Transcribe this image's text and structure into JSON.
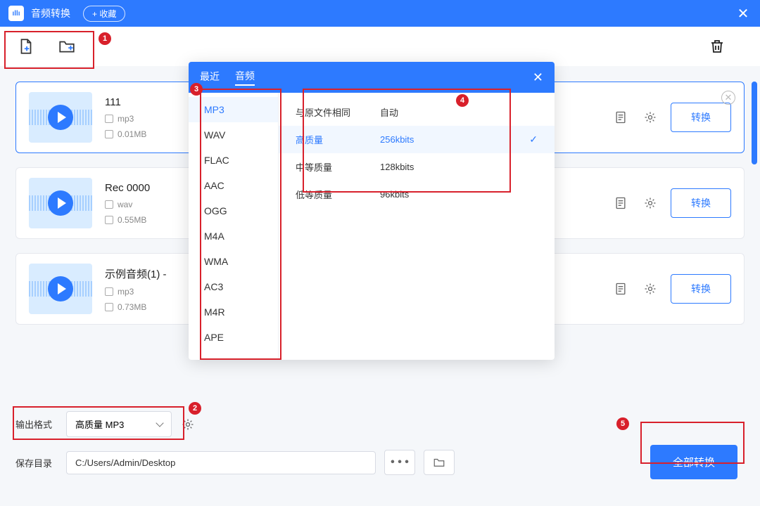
{
  "app": {
    "title": "音频转换",
    "favorite": "+ 收藏"
  },
  "popup": {
    "tabs": {
      "recent": "最近",
      "audio": "音频"
    },
    "formats": [
      "MP3",
      "WAV",
      "FLAC",
      "AAC",
      "OGG",
      "M4A",
      "WMA",
      "AC3",
      "M4R",
      "APE"
    ],
    "quality_rows": [
      {
        "label": "与原文件相同",
        "rate": "自动",
        "active": false
      },
      {
        "label": "高质量",
        "rate": "256kbits",
        "active": true
      },
      {
        "label": "中等质量",
        "rate": "128kbits",
        "active": false
      },
      {
        "label": "低等质量",
        "rate": "96kbits",
        "active": false
      }
    ]
  },
  "files": [
    {
      "name": "111",
      "ext": "mp3",
      "size": "0.01MB"
    },
    {
      "name": "Rec 0000",
      "ext": "wav",
      "size": "0.55MB"
    },
    {
      "name": "示例音频(1) -",
      "ext": "mp3",
      "size": "0.73MB"
    }
  ],
  "actions": {
    "convert": "转换",
    "convert_all": "全部转换"
  },
  "output": {
    "format_label": "输出格式",
    "format_value": "高质量 MP3",
    "save_label": "保存目录",
    "save_path": "C:/Users/Admin/Desktop",
    "dots": "• • •"
  },
  "markers": {
    "m1": "1",
    "m2": "2",
    "m3": "3",
    "m4": "4",
    "m5": "5"
  }
}
